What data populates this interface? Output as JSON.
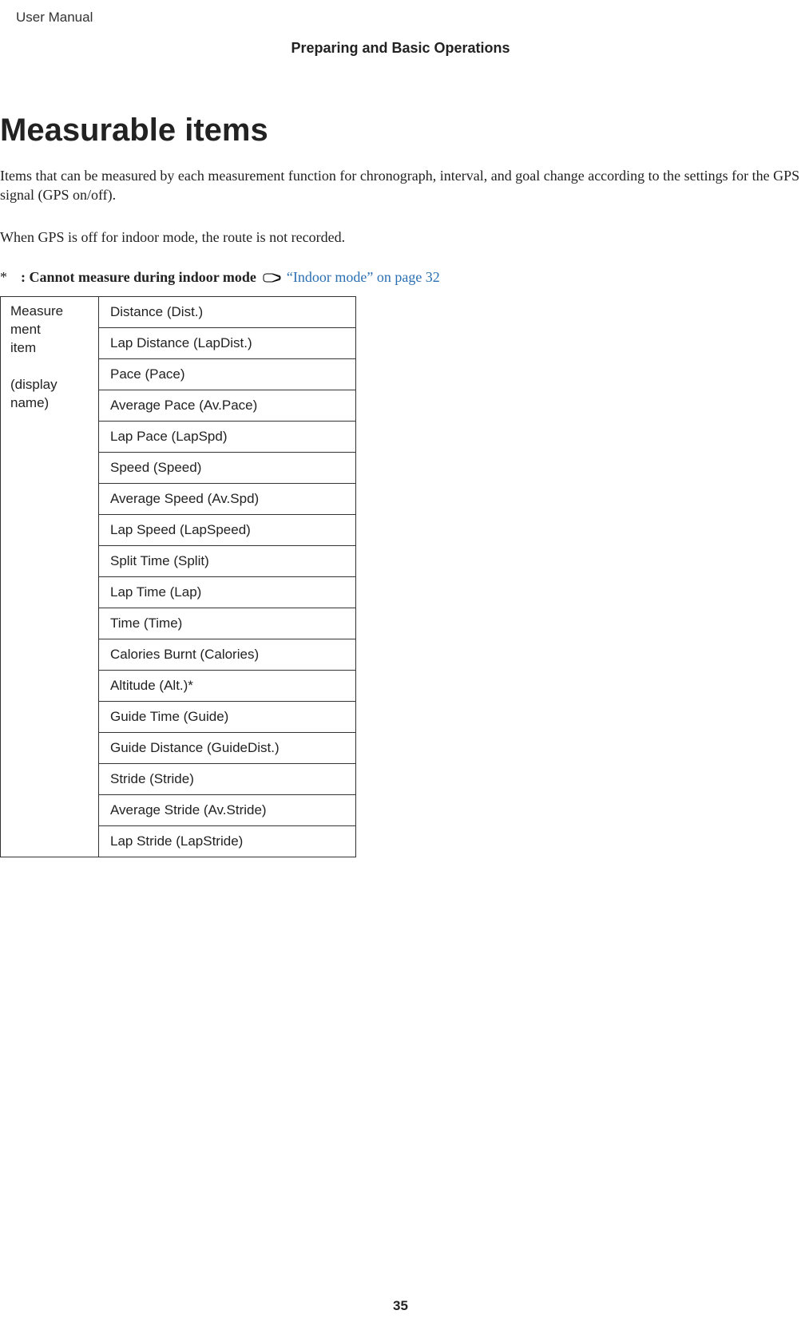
{
  "header": {
    "doc_type": "User Manual",
    "section": "Preparing and Basic Operations"
  },
  "title": "Measurable items",
  "paragraphs": {
    "intro": "Items that can be measured by each measurement function for chronograph, interval, and goal change according to the settings for the GPS signal (GPS on/off).",
    "indoor_note": "When GPS is off for indoor mode, the route is not recorded."
  },
  "footnote": {
    "marker": "*",
    "text": ": Cannot measure during indoor mode",
    "link_text": "“Indoor mode” on page 32"
  },
  "table": {
    "left_label_line1": "Measure",
    "left_label_line2": "ment",
    "left_label_line3": "item",
    "left_label_line4": "(display",
    "left_label_line5": "name)",
    "items": [
      "Distance (Dist.)",
      "Lap Distance (LapDist.)",
      "Pace (Pace)",
      "Average Pace (Av.Pace)",
      "Lap Pace (LapSpd)",
      "Speed (Speed)",
      "Average Speed (Av.Spd)",
      "Lap Speed (LapSpeed)",
      "Split Time (Split)",
      "Lap Time (Lap)",
      "Time (Time)",
      "Calories Burnt (Calories)",
      "Altitude (Alt.)*",
      "Guide Time (Guide)",
      "Guide Distance (GuideDist.)",
      "Stride (Stride)",
      "Average Stride (Av.Stride)",
      "Lap Stride (LapStride)"
    ]
  },
  "page_number": "35"
}
